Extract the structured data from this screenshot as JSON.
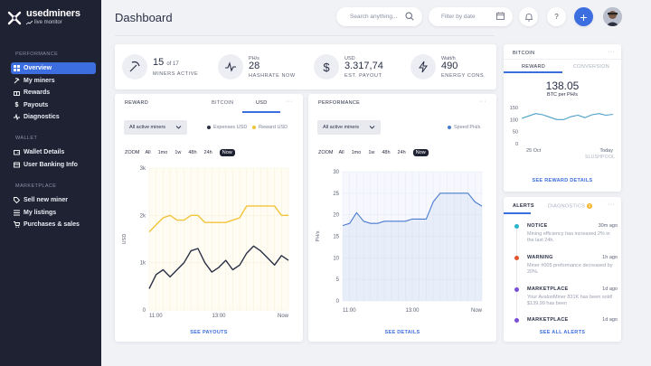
{
  "app": {
    "name": "usedminers",
    "subtitle": "live monitor"
  },
  "nav": {
    "sections": [
      {
        "title": "Performance",
        "items": [
          {
            "label": "Overview",
            "active": true,
            "icon": "grid-icon"
          },
          {
            "label": "My miners",
            "icon": "pickaxe-icon"
          },
          {
            "label": "Rewards",
            "icon": "gift-icon"
          },
          {
            "label": "Payouts",
            "icon": "dollar-icon"
          },
          {
            "label": "Diagnostics",
            "icon": "pulse-icon"
          }
        ]
      },
      {
        "title": "Wallet",
        "items": [
          {
            "label": "Wallet Details",
            "icon": "wallet-icon"
          },
          {
            "label": "User Banking Info",
            "icon": "card-icon"
          }
        ]
      },
      {
        "title": "Marketplace",
        "items": [
          {
            "label": "Sell new miner",
            "icon": "tag-icon"
          },
          {
            "label": "My listings",
            "icon": "list-icon"
          },
          {
            "label": "Purchases & sales",
            "icon": "cart-icon"
          }
        ]
      }
    ]
  },
  "header": {
    "title": "Dashboard",
    "search_placeholder": "Search anything...",
    "date_placeholder": "Filter by date",
    "help": "?",
    "add": "+"
  },
  "stats": [
    {
      "value": "15",
      "suffix": "of 17",
      "unit": "",
      "label": "MINERS ACTIVE",
      "icon": "pickaxe-icon"
    },
    {
      "value": "28",
      "suffix": "",
      "unit": "PH/s",
      "label": "HASHRATE NOW",
      "icon": "pulse-icon"
    },
    {
      "value": "3.317,74",
      "suffix": "",
      "unit": "USD",
      "label": "EST. PAYOUT",
      "icon": "dollar-icon"
    },
    {
      "value": "490",
      "suffix": "",
      "unit": "Watt/h",
      "label": "ENERGY CONS.",
      "icon": "bolt-icon"
    }
  ],
  "reward_card": {
    "title": "REWARD",
    "tabs": [
      "BITCOIN",
      "USD"
    ],
    "active_tab": "USD",
    "select": "All active miners",
    "legend": [
      "Expenses USD",
      "Reward USD"
    ],
    "zoom_label": "ZOOM",
    "zoom": [
      "All",
      "1mo",
      "1w",
      "48h",
      "24h",
      "Now"
    ],
    "zoom_active": "Now",
    "footer": "SEE PAYOUTS"
  },
  "performance_card": {
    "title": "PERFORMANCE",
    "select": "All active miners",
    "legend": [
      "Speed PH/s"
    ],
    "zoom_label": "ZOOM",
    "zoom": [
      "All",
      "1mo",
      "1w",
      "48h",
      "24h",
      "Now"
    ],
    "zoom_active": "Now",
    "footer": "SEE DETAILS"
  },
  "bitcoin_card": {
    "title": "BITCOIN",
    "tabs": [
      "REWARD",
      "CONVERSION"
    ],
    "active_tab": "REWARD",
    "value": "138.05",
    "unit": "BTC per PH/s",
    "footer": "SEE REWARD DETAILS",
    "source": "SLUSHPOOL"
  },
  "alerts_card": {
    "tabs": [
      "ALERTS",
      "DIAGNOSTICS"
    ],
    "diagnostics_count": "2",
    "items": [
      {
        "type": "NOTICE",
        "time": "30m ago",
        "message": "Mining efficiency has increased 2% in the last 24h.",
        "color": "#2bb3c9"
      },
      {
        "type": "WARNING",
        "time": "1h ago",
        "message": "Miner #005 preformance decreased by 20%.",
        "color": "#e0542c"
      },
      {
        "type": "MARKETPLACE",
        "time": "1d ago",
        "message": "Your AvalonMiner 831K has been sold! $139,99 has been",
        "color": "#7a4fd6"
      },
      {
        "type": "MARKETPLACE",
        "time": "1d ago",
        "message": "",
        "color": "#7a4fd6"
      }
    ],
    "footer": "SEE ALL ALERTS"
  },
  "colors": {
    "accent": "#3d6ee0",
    "expenses": "#2a2f45",
    "reward": "#f3c33a",
    "speed": "#4a7bd0"
  },
  "chart_data": [
    {
      "type": "line",
      "title": "REWARD",
      "xlabel": "",
      "ylabel": "USD",
      "x_ticks": [
        "11:00",
        "13:00",
        "Now"
      ],
      "y_ticks": [
        "0",
        "1k",
        "2k",
        "3k"
      ],
      "ylim": [
        0,
        3000
      ],
      "x": [
        0,
        1,
        2,
        3,
        4,
        5,
        6,
        7,
        8,
        9,
        10,
        11,
        12,
        13,
        14,
        15,
        16,
        17,
        18,
        19,
        20
      ],
      "series": [
        {
          "name": "Expenses USD",
          "color": "#2a2f45",
          "values": [
            450,
            750,
            850,
            700,
            850,
            1000,
            1250,
            1300,
            1000,
            800,
            900,
            1050,
            850,
            950,
            1200,
            1350,
            1250,
            1100,
            950,
            1150,
            1050
          ]
        },
        {
          "name": "Reward USD",
          "color": "#f3c33a",
          "values": [
            1650,
            1800,
            1950,
            2000,
            1900,
            1900,
            2000,
            2000,
            1850,
            1850,
            1850,
            1850,
            1900,
            1950,
            2200,
            2200,
            2200,
            2200,
            2200,
            2000,
            2000
          ]
        }
      ]
    },
    {
      "type": "area",
      "title": "PERFORMANCE",
      "xlabel": "",
      "ylabel": "PH/s",
      "x_ticks": [
        "11:00",
        "13:00",
        "Now"
      ],
      "y_ticks": [
        "0",
        "5",
        "10",
        "15",
        "20",
        "25",
        "30"
      ],
      "ylim": [
        0,
        30
      ],
      "x": [
        0,
        1,
        2,
        3,
        4,
        5,
        6,
        7,
        8,
        9,
        10,
        11,
        12,
        13,
        14,
        15,
        16,
        17,
        18,
        19,
        20
      ],
      "series": [
        {
          "name": "Speed PH/s",
          "color": "#4a7bd0",
          "values": [
            17.5,
            18,
            20.5,
            18.5,
            18,
            18,
            18.5,
            18.5,
            18.5,
            18.5,
            19,
            19,
            19,
            23,
            25,
            25,
            25,
            25,
            25,
            23,
            22
          ]
        }
      ]
    },
    {
      "type": "line",
      "title": "BITCOIN",
      "xlabel": "",
      "ylabel": "",
      "x_ticks": [
        "25 Oct",
        "Today"
      ],
      "y_ticks": [
        "0",
        "50",
        "100",
        "150"
      ],
      "ylim": [
        0,
        150
      ],
      "x": [
        0,
        1,
        2,
        3,
        4,
        5,
        6,
        7,
        8,
        9,
        10,
        11,
        12,
        13
      ],
      "series": [
        {
          "name": "",
          "color": "#4da0c7",
          "values": [
            105,
            115,
            125,
            120,
            110,
            100,
            100,
            112,
            118,
            108,
            120,
            125,
            118,
            122
          ]
        }
      ]
    }
  ]
}
